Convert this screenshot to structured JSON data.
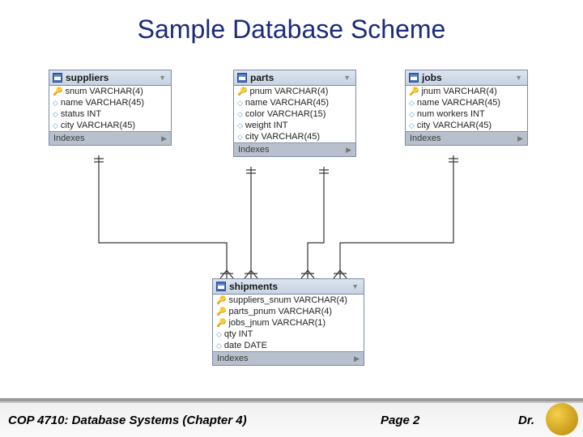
{
  "title": "Sample Database Scheme",
  "tables": {
    "suppliers": {
      "name": "suppliers",
      "columns": [
        {
          "icon": "key",
          "text": "snum VARCHAR(4)"
        },
        {
          "icon": "dia",
          "text": "name VARCHAR(45)"
        },
        {
          "icon": "dia",
          "text": "status INT"
        },
        {
          "icon": "dia",
          "text": "city VARCHAR(45)"
        }
      ],
      "footer": "Indexes"
    },
    "parts": {
      "name": "parts",
      "columns": [
        {
          "icon": "key",
          "text": "pnum VARCHAR(4)"
        },
        {
          "icon": "dia",
          "text": "name VARCHAR(45)"
        },
        {
          "icon": "dia",
          "text": "color VARCHAR(15)"
        },
        {
          "icon": "dia",
          "text": "weight INT"
        },
        {
          "icon": "dia",
          "text": "city VARCHAR(45)"
        }
      ],
      "footer": "Indexes"
    },
    "jobs": {
      "name": "jobs",
      "columns": [
        {
          "icon": "key",
          "text": "jnum VARCHAR(4)"
        },
        {
          "icon": "dia",
          "text": "name VARCHAR(45)"
        },
        {
          "icon": "dia",
          "text": "num workers INT"
        },
        {
          "icon": "dia",
          "text": "city VARCHAR(45)"
        }
      ],
      "footer": "Indexes"
    },
    "shipments": {
      "name": "shipments",
      "columns": [
        {
          "icon": "key",
          "text": "suppliers_snum VARCHAR(4)"
        },
        {
          "icon": "key",
          "text": "parts_pnum VARCHAR(4)"
        },
        {
          "icon": "key",
          "text": "jobs_jnum VARCHAR(1)"
        },
        {
          "icon": "dia",
          "text": "qty INT"
        },
        {
          "icon": "dia",
          "text": "date DATE"
        }
      ],
      "footer": "Indexes"
    }
  },
  "footer": {
    "left": "COP 4710: Database Systems  (Chapter 4)",
    "page": "Page 2",
    "right": "Dr."
  }
}
